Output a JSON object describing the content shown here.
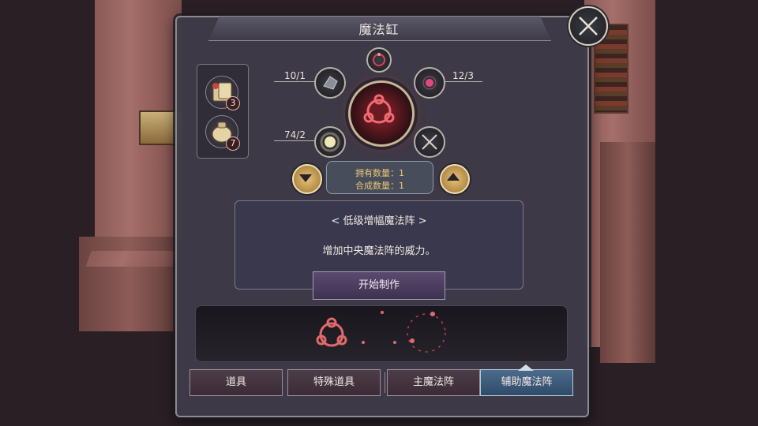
{
  "window": {
    "title": "魔法缸",
    "close_icon": "close-x-icon"
  },
  "materials": [
    {
      "icon": "scroll-bundle-icon",
      "count": "3"
    },
    {
      "icon": "pouch-icon",
      "count": "7"
    }
  ],
  "recipe": {
    "top_icon": "small-circle-rune-icon",
    "slots": [
      {
        "ratio": "10/1",
        "icon": "stone-shard-icon"
      },
      {
        "ratio": "12/3",
        "icon": "pink-gem-icon"
      },
      {
        "ratio": "74/2",
        "icon": "glowing-spark-icon"
      },
      {
        "ratio": "",
        "icon": "empty-slot-x-icon"
      }
    ],
    "center_icon": "red-magic-circle-icon",
    "owned_label": "拥有数量：1",
    "craft_count_label": "合成数量：1",
    "down_icon": "chevron-down-icon",
    "up_icon": "chevron-up-icon"
  },
  "description": {
    "title": "< 低级增幅魔法阵 >",
    "text": "增加中央魔法阵的威力。"
  },
  "craft_button": {
    "label": "开始制作"
  },
  "tabs": [
    {
      "label": "道具",
      "active": false
    },
    {
      "label": "特殊道具",
      "active": false
    },
    {
      "label": "主魔法阵",
      "active": false
    },
    {
      "label": "辅助魔法阵",
      "active": true
    }
  ],
  "colors": {
    "panel_bg": "#3e3a48",
    "accent_gold": "#e8c574",
    "active_tab": "#4c6c8c",
    "magic_red": "#d9444e"
  }
}
